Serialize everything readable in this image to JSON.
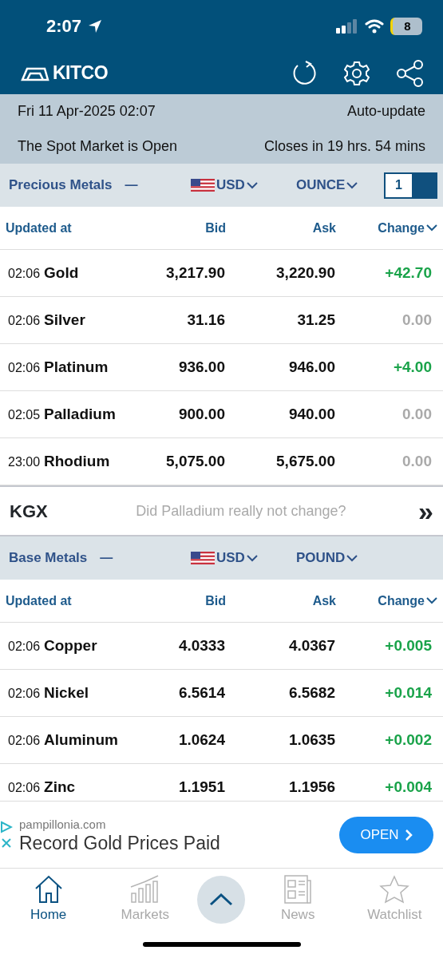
{
  "status_bar": {
    "time": "2:07",
    "battery": "8"
  },
  "header": {
    "logo": "KITCO"
  },
  "market_info": {
    "date": "Fri 11 Apr-2025 02:07",
    "auto_update": "Auto-update",
    "status": "The Spot Market is Open",
    "closes": "Closes in 19 hrs. 54 mins"
  },
  "sections": [
    {
      "title": "Precious Metals",
      "collapse": "—",
      "currency": "USD",
      "unit": "OUNCE",
      "quantity": "1",
      "columns": [
        "Updated at",
        "Bid",
        "Ask",
        "Change"
      ],
      "rows": [
        {
          "time": "02:06",
          "name": "Gold",
          "bid": "3,217.90",
          "ask": "3,220.90",
          "change": "+42.70",
          "kind": "up"
        },
        {
          "time": "02:06",
          "name": "Silver",
          "bid": "31.16",
          "ask": "31.25",
          "change": "0.00",
          "kind": "flat"
        },
        {
          "time": "02:06",
          "name": "Platinum",
          "bid": "936.00",
          "ask": "946.00",
          "change": "+4.00",
          "kind": "up"
        },
        {
          "time": "02:05",
          "name": "Palladium",
          "bid": "900.00",
          "ask": "940.00",
          "change": "0.00",
          "kind": "flat"
        },
        {
          "time": "23:00",
          "name": "Rhodium",
          "bid": "5,075.00",
          "ask": "5,675.00",
          "change": "0.00",
          "kind": "flat"
        }
      ]
    },
    {
      "title": "Base Metals",
      "collapse": "—",
      "currency": "USD",
      "unit": "POUND",
      "columns": [
        "Updated at",
        "Bid",
        "Ask",
        "Change"
      ],
      "rows": [
        {
          "time": "02:06",
          "name": "Copper",
          "bid": "4.0333",
          "ask": "4.0367",
          "change": "+0.005",
          "kind": "up"
        },
        {
          "time": "02:06",
          "name": "Nickel",
          "bid": "6.5614",
          "ask": "6.5682",
          "change": "+0.014",
          "kind": "up"
        },
        {
          "time": "02:06",
          "name": "Aluminum",
          "bid": "1.0624",
          "ask": "1.0635",
          "change": "+0.002",
          "kind": "up"
        },
        {
          "time": "02:06",
          "name": "Zinc",
          "bid": "1.1951",
          "ask": "1.1956",
          "change": "+0.004",
          "kind": "up"
        }
      ]
    }
  ],
  "kgx": {
    "label": "KGX",
    "question": "Did Palladium really not change?",
    "arrow": "»"
  },
  "ad": {
    "domain": "pampillonia.com",
    "headline": "Record Gold Prices Paid",
    "button": "OPEN"
  },
  "tab_bar": [
    {
      "label": "Home",
      "selected": true,
      "kind": "home"
    },
    {
      "label": "Markets",
      "selected": false,
      "kind": "markets"
    },
    {
      "kind": "up"
    },
    {
      "label": "News",
      "selected": false,
      "kind": "news"
    },
    {
      "label": "Watchlist",
      "selected": false,
      "kind": "star"
    }
  ]
}
